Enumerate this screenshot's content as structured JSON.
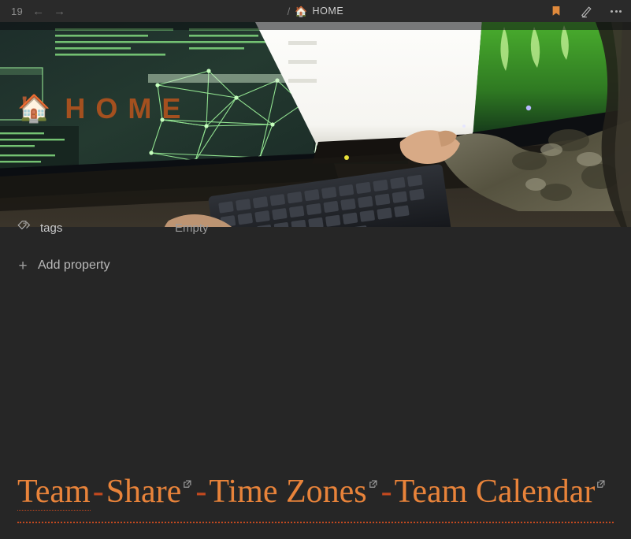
{
  "topbar": {
    "tab_count": "19",
    "back_icon": "arrow-left-icon",
    "back_glyph": "←",
    "forward_icon": "arrow-right-icon",
    "forward_glyph": "→",
    "breadcrumb": {
      "separator": "/",
      "emoji": "🏠",
      "title": "HOME"
    },
    "actions": {
      "bookmark": "bookmark-icon",
      "edit": "pencil-icon",
      "more": "more-options-icon"
    }
  },
  "banner": {
    "alt": "photo of a person in camouflage at a desk with monitors showing green network graphs and code",
    "emoji": "🏠",
    "title": "HOME",
    "title_color": "#a4501f"
  },
  "properties": {
    "rows": [
      {
        "icon": "tag-icon",
        "key": "tags",
        "value": "Empty"
      }
    ],
    "add_property": {
      "plus": "+",
      "label": "Add property"
    }
  },
  "content": {
    "link_line": {
      "separator": "-",
      "items": [
        {
          "label": "Team",
          "external": false
        },
        {
          "label": "Share",
          "external": true
        },
        {
          "label": "Time Zones",
          "external": true
        },
        {
          "label": "Team Calendar",
          "external": true
        }
      ]
    }
  },
  "colors": {
    "background": "#262626",
    "topbar": "#2a2a2a",
    "accent_orange": "#e8833a",
    "accent_rust": "#c4491f",
    "bookmark_orange": "#e08a3c",
    "text_primary": "#dadada",
    "text_muted": "#9a9a9a"
  }
}
